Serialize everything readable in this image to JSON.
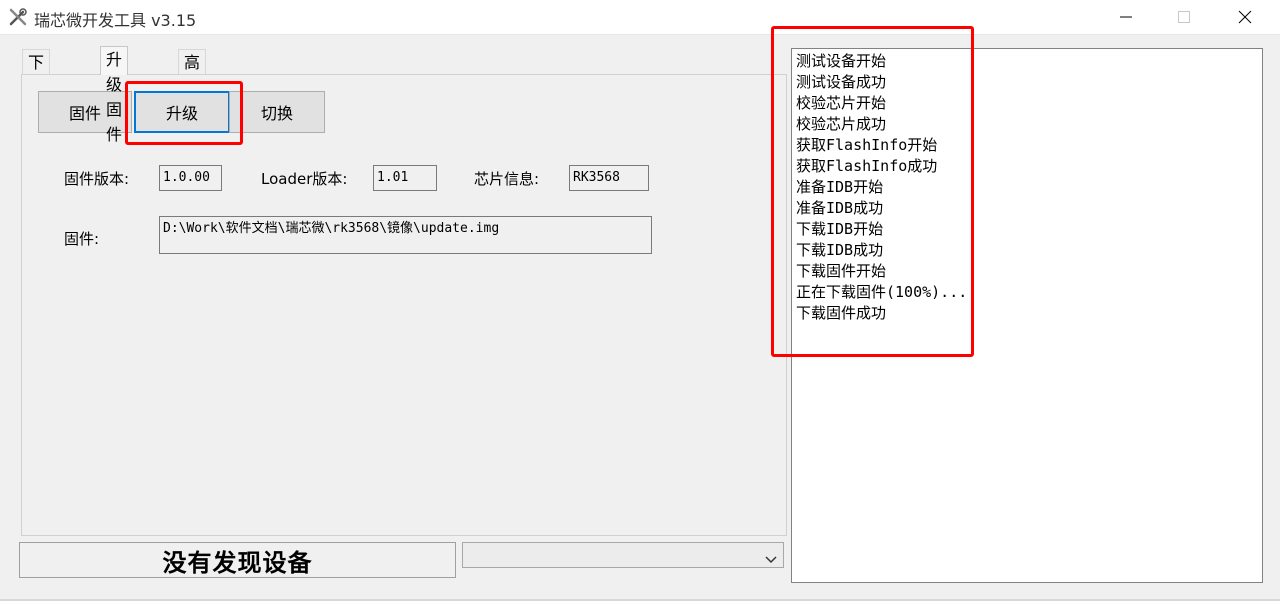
{
  "window": {
    "title": "瑞芯微开发工具 v3.15",
    "icon": "tools-icon"
  },
  "tabs": [
    {
      "label": "下载镜像",
      "active": false
    },
    {
      "label": "升级固件",
      "active": true
    },
    {
      "label": "高级功能",
      "active": false
    }
  ],
  "buttons": {
    "firmware": "固件",
    "upgrade": "升级",
    "switch": "切换"
  },
  "info": {
    "firmware_version_label": "固件版本:",
    "firmware_version_value": "1.0.00",
    "loader_version_label": "Loader版本:",
    "loader_version_value": "1.01",
    "chip_info_label": "芯片信息:",
    "chip_info_value": "RK3568",
    "firmware_path_label": "固件:",
    "firmware_path_value": "D:\\Work\\软件文档\\瑞芯微\\rk3568\\镜像\\update.img"
  },
  "status": {
    "text": "没有发现设备"
  },
  "device_select": {
    "value": ""
  },
  "log": {
    "lines": [
      "测试设备开始",
      "测试设备成功",
      "校验芯片开始",
      "校验芯片成功",
      "获取FlashInfo开始",
      "获取FlashInfo成功",
      "准备IDB开始",
      "准备IDB成功",
      "下载IDB开始",
      "下载IDB成功",
      "下载固件开始",
      "正在下载固件(100%)...",
      "下载固件成功"
    ]
  },
  "colors": {
    "highlight_red": "#ff0000",
    "focus_blue": "#0078d7"
  }
}
